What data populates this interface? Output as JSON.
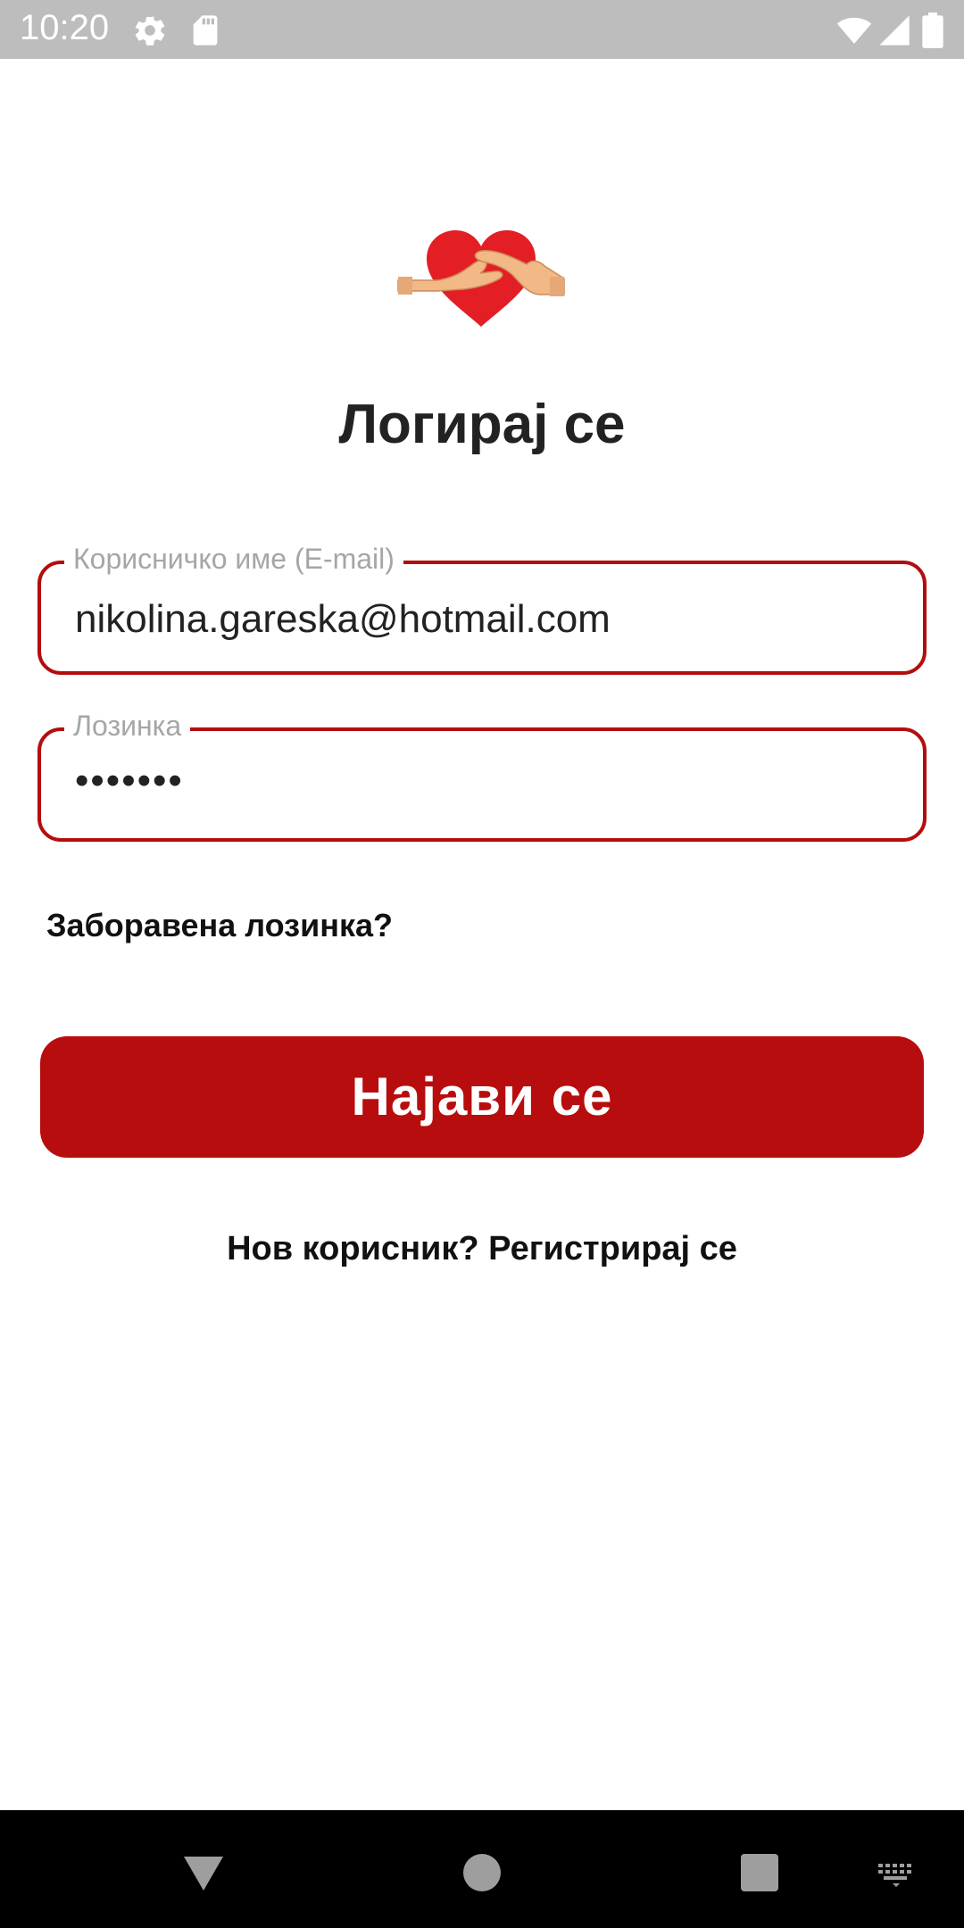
{
  "status_bar": {
    "time": "10:20",
    "icons": [
      "gear-icon",
      "sd-card-icon",
      "wifi-icon",
      "signal-icon",
      "battery-icon"
    ]
  },
  "logo": {
    "icon": "heart-hands-icon",
    "colors": {
      "heart": "#e31e24",
      "skin": "#f2b886"
    }
  },
  "login": {
    "title": "Логирај се",
    "email_label": "Корисничко име (E-mail)",
    "email_value": "nikolina.gareska@hotmail.com",
    "password_label": "Лозинка",
    "password_value": "•••••••",
    "forgot_password": "Заборавена лозинка?",
    "submit_label": "Најави се",
    "register_prompt": "Нов корисник? Регистрирај се"
  },
  "theme": {
    "accent": "#b80d0e",
    "field_border": "#b40d0e",
    "label_color": "#a6a6a6"
  },
  "nav_bar": {
    "buttons": [
      "back-icon",
      "home-icon",
      "recents-icon",
      "keyboard-icon"
    ]
  }
}
